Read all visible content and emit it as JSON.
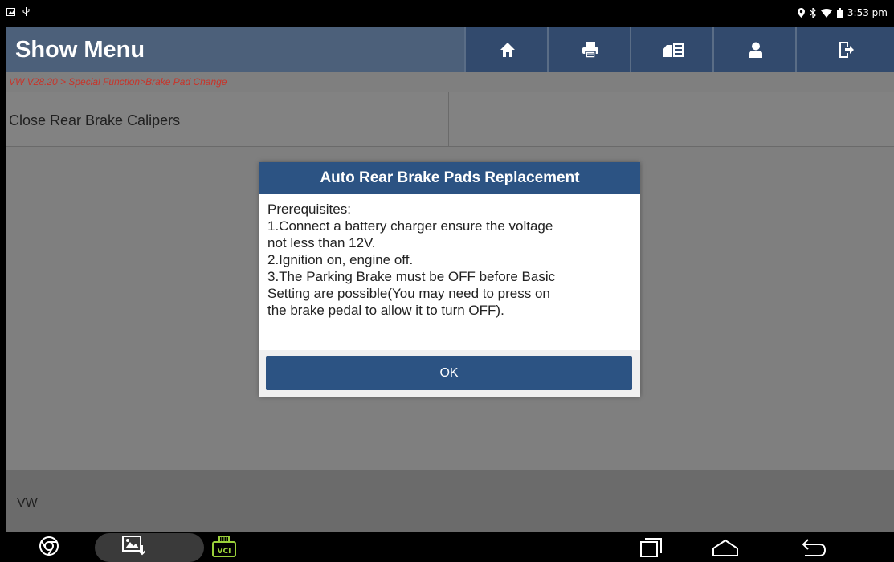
{
  "status_bar": {
    "time": "3:53 pm",
    "left_icons": [
      "gallery-notification-icon",
      "usb-debug-icon"
    ],
    "right_icons": [
      "location-icon",
      "bluetooth-icon",
      "wifi-icon",
      "battery-icon"
    ]
  },
  "header": {
    "title": "Show Menu",
    "buttons": [
      "home-icon",
      "print-icon",
      "report-icon",
      "user-icon",
      "exit-icon"
    ],
    "colors": {
      "bar": "#4c607a",
      "button": "#324a6d"
    }
  },
  "breadcrumb": "VW V28.20 > Special Function>Brake Pad Change",
  "menu": {
    "items": [
      {
        "label": "Close Rear Brake Calipers"
      }
    ]
  },
  "footer": {
    "brand": "VW"
  },
  "dialog": {
    "title": "Auto Rear Brake Pads Replacement",
    "lines": [
      "Prerequisites:",
      "1.Connect a battery charger ensure the voltage",
      "not less than 12V.",
      "2.Ignition on, engine off.",
      "3.The Parking Brake must be OFF before Basic",
      "Setting are possible(You may need to press on",
      "the brake pedal to allow it to turn OFF)."
    ],
    "ok_label": "OK",
    "accent": "#2c5383"
  },
  "nav_bar": {
    "icons": [
      "chrome-icon",
      "screenshot-icon",
      "vci-icon",
      "recent-apps-icon",
      "home-nav-icon",
      "back-icon"
    ],
    "vci_label": "VCI"
  }
}
